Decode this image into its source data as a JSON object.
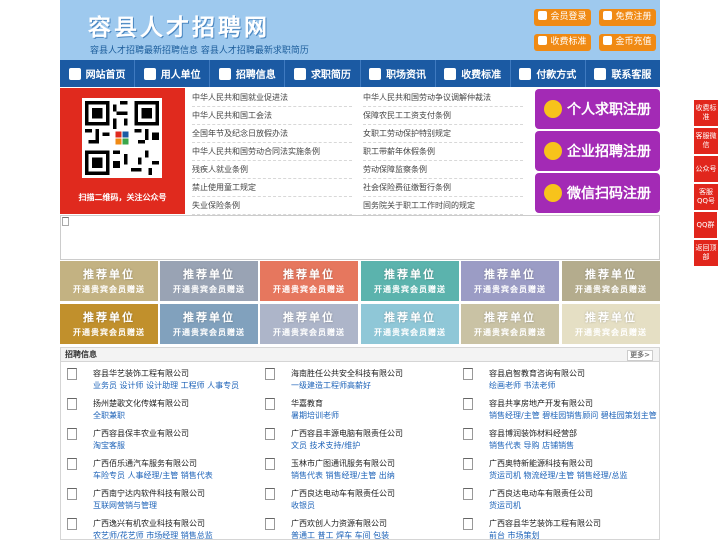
{
  "header": {
    "title": "容县人才招聘网",
    "subtitle": "容县人才招聘最新招聘信息    容县人才招聘最新求职简历",
    "buttons": [
      "会员登录",
      "免费注册",
      "收费标准",
      "金币充值"
    ]
  },
  "nav": [
    "网站首页",
    "用人单位",
    "招聘信息",
    "求职简历",
    "职场资讯",
    "收费标准",
    "付款方式",
    "联系客服"
  ],
  "qr": {
    "caption": "扫描二维码，关注公众号"
  },
  "laws": {
    "left": [
      "中华人民共和国就业促进法",
      "中华人民共和国工会法",
      "全国年节及纪念日放假办法",
      "中华人民共和国劳动合同法实施条例",
      "残疾人就业条例",
      "禁止使用童工规定",
      "失业保险条例"
    ],
    "right": [
      "中华人民共和国劳动争议调解仲裁法",
      "保障农民工工资支付条例",
      "女职工劳动保护特别规定",
      "职工带薪年休假条例",
      "劳动保障监察条例",
      "社会保险费征缴暂行条例",
      "国务院关于职工工作时间的规定"
    ]
  },
  "register": [
    "个人求职注册",
    "企业招聘注册",
    "微信扫码注册"
  ],
  "promo": {
    "title": "推荐单位",
    "subtitle": "开通贵宾会员赠送",
    "colors": [
      "#c3b282",
      "#99a3b4",
      "#e6775e",
      "#5bb3ad",
      "#9b9cc5",
      "#b4ac8d",
      "#c1902c",
      "#81a1bd",
      "#adb5c9",
      "#8fc7d7",
      "#c9c2a4",
      "#e5dfc4"
    ]
  },
  "jobs": {
    "heading": "招聘信息",
    "more": "更多>",
    "columns": [
      [
        {
          "company": "容县华艺装饰工程有限公司",
          "positions": "业务员 设计师 设计助理 工程师 人事专员"
        },
        {
          "company": "扬州楚歌文化传媒有限公司",
          "positions": "全职兼职"
        },
        {
          "company": "广西容县保丰农业有限公司",
          "positions": "淘宝客服"
        },
        {
          "company": "广西佰乐通汽车服务有限公司",
          "positions": "车险专员 人事经理/主管 销售代表"
        },
        {
          "company": "广西南宁达内软件科技有限公司",
          "positions": "互联网营销与管理"
        },
        {
          "company": "广西逸兴有机农业科技有限公司",
          "positions": "农艺师/花艺师 市场经理 销售总监"
        }
      ],
      [
        {
          "company": "海南胜任公共安全科技有限公司",
          "positions": "一级建造工程师高薪好"
        },
        {
          "company": "华嘉教育",
          "positions": "暑期培训老师"
        },
        {
          "company": "广西容县丰源电脑有限责任公司",
          "positions": "文员 技术支持/维护"
        },
        {
          "company": "玉林市广图通讯服务有限公司",
          "positions": "销售代表 销售经理/主管 出纳"
        },
        {
          "company": "广西良达电动车有限责任公司",
          "positions": "收银员"
        },
        {
          "company": "广西欢创人力资源有限公司",
          "positions": "普通工 普工 焊车 车间 包装"
        }
      ],
      [
        {
          "company": "容县启智教育咨询有限公司",
          "positions": "绘画老师 书法老师"
        },
        {
          "company": "容县共享房地产开发有限公司",
          "positions": "销售经理/主管 碧桂园销售顾问 碧桂园策划主管"
        },
        {
          "company": "容县博润装饰材料经营部",
          "positions": "销售代表 导购 店铺销售"
        },
        {
          "company": "广西奥特新能源科技有限公司",
          "positions": "货运司机 物流经理/主管 销售经理/总监"
        },
        {
          "company": "广西良达电动车有限责任公司",
          "positions": "货运司机"
        },
        {
          "company": "广西容县华艺装饰工程有限公司",
          "positions": "前台 市场策划"
        }
      ]
    ]
  },
  "side": [
    "收费标准",
    "客服微信",
    "公众号",
    "客服QQ号",
    "QQ群",
    "返回顶部"
  ]
}
